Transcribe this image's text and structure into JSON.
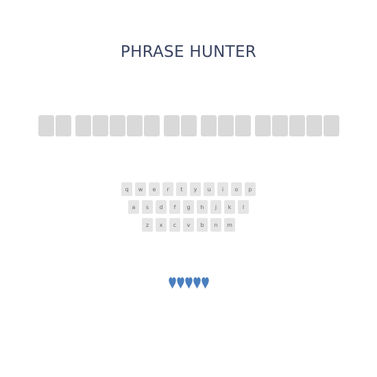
{
  "title": "PHRASE HUNTER",
  "phrase": {
    "words": [
      2,
      5,
      2,
      3,
      5
    ]
  },
  "keyboard": {
    "rows": [
      [
        "q",
        "w",
        "e",
        "r",
        "t",
        "y",
        "u",
        "i",
        "o",
        "p"
      ],
      [
        "a",
        "s",
        "d",
        "f",
        "g",
        "h",
        "j",
        "k",
        "l"
      ],
      [
        "z",
        "x",
        "c",
        "v",
        "b",
        "n",
        "m"
      ]
    ]
  },
  "lives": {
    "count": 5,
    "icon": "heart-icon",
    "color": "#4a7fbf"
  },
  "colors": {
    "title": "#3a4462",
    "tile": "#d9d9d9",
    "key": "#e5e5e5"
  }
}
